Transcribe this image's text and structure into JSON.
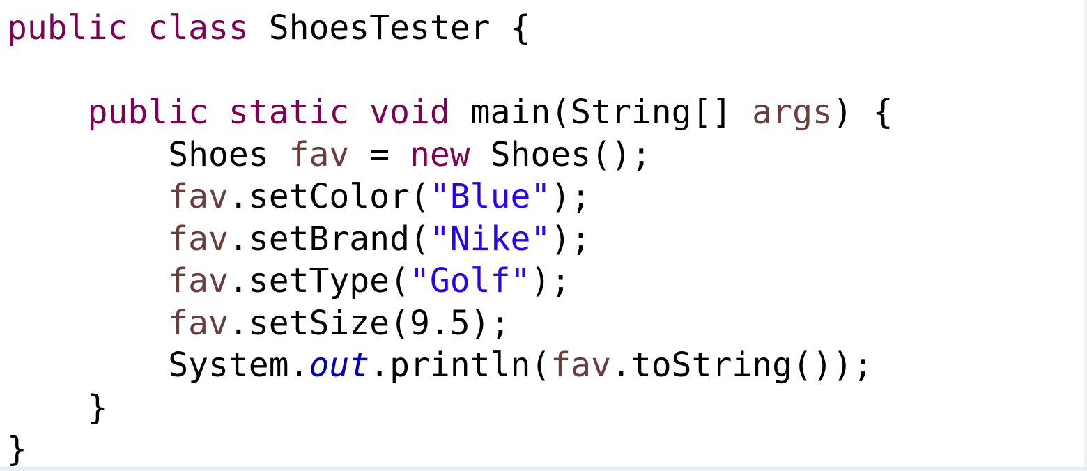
{
  "editor": {
    "language": "Java",
    "lines": [
      [
        {
          "t": "public",
          "c": "kw"
        },
        {
          "t": " ",
          "c": ""
        },
        {
          "t": "class",
          "c": "kw"
        },
        {
          "t": " ShoesTester {",
          "c": ""
        }
      ],
      [],
      [
        {
          "t": "    ",
          "c": ""
        },
        {
          "t": "public",
          "c": "kw"
        },
        {
          "t": " ",
          "c": ""
        },
        {
          "t": "static",
          "c": "kw"
        },
        {
          "t": " ",
          "c": ""
        },
        {
          "t": "void",
          "c": "kw"
        },
        {
          "t": " main(String[] ",
          "c": ""
        },
        {
          "t": "args",
          "c": "var"
        },
        {
          "t": ") {",
          "c": ""
        }
      ],
      [
        {
          "t": "        Shoes ",
          "c": ""
        },
        {
          "t": "fav",
          "c": "var"
        },
        {
          "t": " = ",
          "c": ""
        },
        {
          "t": "new",
          "c": "kw"
        },
        {
          "t": " Shoes();",
          "c": ""
        }
      ],
      [
        {
          "t": "        ",
          "c": ""
        },
        {
          "t": "fav",
          "c": "var"
        },
        {
          "t": ".setColor(",
          "c": ""
        },
        {
          "t": "\"Blue\"",
          "c": "str"
        },
        {
          "t": ");",
          "c": ""
        }
      ],
      [
        {
          "t": "        ",
          "c": ""
        },
        {
          "t": "fav",
          "c": "var"
        },
        {
          "t": ".setBrand(",
          "c": ""
        },
        {
          "t": "\"Nike\"",
          "c": "str"
        },
        {
          "t": ");",
          "c": ""
        }
      ],
      [
        {
          "t": "        ",
          "c": ""
        },
        {
          "t": "fav",
          "c": "var"
        },
        {
          "t": ".setType(",
          "c": ""
        },
        {
          "t": "\"Golf\"",
          "c": "str"
        },
        {
          "t": ");",
          "c": ""
        }
      ],
      [
        {
          "t": "        ",
          "c": ""
        },
        {
          "t": "fav",
          "c": "var"
        },
        {
          "t": ".setSize(9.5);",
          "c": ""
        }
      ],
      [
        {
          "t": "        System.",
          "c": ""
        },
        {
          "t": "out",
          "c": "field"
        },
        {
          "t": ".println(",
          "c": ""
        },
        {
          "t": "fav",
          "c": "var"
        },
        {
          "t": ".toString());",
          "c": ""
        }
      ],
      [
        {
          "t": "    }",
          "c": ""
        }
      ],
      [
        {
          "t": "}",
          "c": ""
        }
      ]
    ]
  },
  "colors": {
    "keyword": "#7f0055",
    "local_variable": "#6a3e3e",
    "string": "#2a00ff",
    "static_field": "#0000c0",
    "plain": "#000000",
    "background": "#ffffff"
  }
}
